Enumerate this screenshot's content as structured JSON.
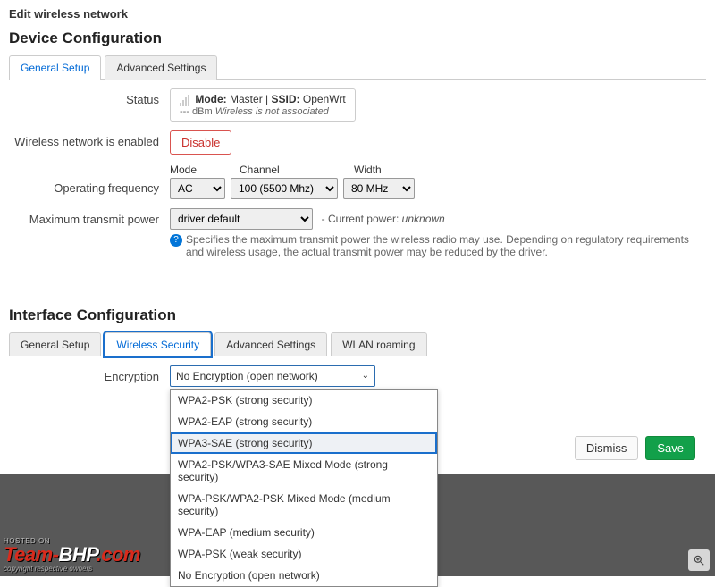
{
  "page_title": "Edit wireless network",
  "device_config": {
    "heading": "Device Configuration",
    "tabs": [
      {
        "label": "General Setup",
        "active": true
      },
      {
        "label": "Advanced Settings",
        "active": false
      }
    ],
    "status": {
      "label": "Status",
      "mode_prefix": "Mode:",
      "mode_value": "Master",
      "ssid_prefix": "SSID:",
      "ssid_value": "OpenWrt",
      "signal_dbm": "--- dBm",
      "assoc_text": "Wireless is not associated"
    },
    "wireless_enabled": {
      "label": "Wireless network is enabled",
      "button": "Disable"
    },
    "operating_frequency": {
      "label": "Operating frequency",
      "mode_label": "Mode",
      "mode_value": "AC",
      "channel_label": "Channel",
      "channel_value": "100 (5500 Mhz)",
      "width_label": "Width",
      "width_value": "80 MHz"
    },
    "max_power": {
      "label": "Maximum transmit power",
      "value": "driver default",
      "current_prefix": "- Current power:",
      "current_value": "unknown",
      "hint": "Specifies the maximum transmit power the wireless radio may use. Depending on regulatory requirements and wireless usage, the actual transmit power may be reduced by the driver."
    }
  },
  "interface_config": {
    "heading": "Interface Configuration",
    "tabs": [
      {
        "label": "General Setup"
      },
      {
        "label": "Wireless Security"
      },
      {
        "label": "Advanced Settings"
      },
      {
        "label": "WLAN roaming"
      }
    ],
    "encryption": {
      "label": "Encryption",
      "selected": "No Encryption (open network)",
      "options": [
        "WPA2-PSK (strong security)",
        "WPA2-EAP (strong security)",
        "WPA3-SAE (strong security)",
        "WPA2-PSK/WPA3-SAE Mixed Mode (strong security)",
        "WPA-PSK/WPA2-PSK Mixed Mode (medium security)",
        "WPA-EAP (medium security)",
        "WPA-PSK (weak security)",
        "No Encryption (open network)"
      ],
      "highlight_index": 2
    }
  },
  "actions": {
    "dismiss": "Dismiss",
    "save": "Save"
  },
  "watermark": {
    "hosted": "HOSTED ON",
    "team": "Team-",
    "bhp": "BHP",
    "com": ".com",
    "copyright": "copyright respective owners"
  }
}
